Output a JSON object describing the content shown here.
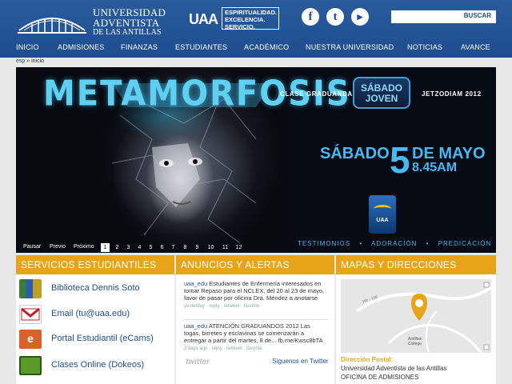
{
  "header": {
    "logo": {
      "line1": "UNIVERSIDAD",
      "line2": "ADVENTISTA",
      "line3": "DE LAS ANTILLAS"
    },
    "mark": "UAA",
    "slogan": [
      "ESPIRITUALIDAD.",
      "EXCELENCIA.",
      "SERVICIO."
    ],
    "social": [
      {
        "name": "facebook-icon",
        "glyph": "f"
      },
      {
        "name": "twitter-icon",
        "glyph": "t"
      },
      {
        "name": "youtube-icon",
        "glyph": "▶"
      }
    ],
    "search": {
      "placeholder": "",
      "button": "BUSCAR"
    }
  },
  "nav": [
    "INICIO",
    "ADMISIONES",
    "FINANZAS",
    "ESTUDIANTES",
    "ACADÉMICO",
    "NUESTRA UNIVERSIDAD",
    "NOTICIAS",
    "AVANCE"
  ],
  "breadcrumb": {
    "home": "esp",
    "sep": " » ",
    "current": "inicio"
  },
  "banner": {
    "title": "METAMORFOSIS",
    "clase": "CLASE GRADUANDA",
    "jetzo": "JETZODIAM 2012",
    "badge_line1": "SÁBADO",
    "badge_line2": "JOVEN",
    "date_day": "SÁBADO",
    "date_num": "5",
    "date_month": "DE MAYO",
    "date_time": "8.45AM",
    "badge_text": "UAA",
    "links": [
      "TESTIMONIOS",
      "•",
      "ADORACIÓN",
      "•",
      "PREDICACIÓN"
    ],
    "controls": {
      "pause": "Pausar",
      "prev": "Previo",
      "next": "Próximo"
    },
    "pages": [
      "1",
      "2",
      "3",
      "4",
      "5",
      "6",
      "7",
      "8",
      "9",
      "10",
      "11",
      "12"
    ],
    "active_page": "1"
  },
  "columns": {
    "servicios": {
      "title": "SERVICIOS ESTUDIANTILES",
      "items": [
        {
          "label": "Biblioteca Dennis Soto",
          "icon": "library-icon",
          "color": "#3a7a3a"
        },
        {
          "label": "Email (tu@uaa.edu)",
          "icon": "email-icon",
          "color": "#c02020"
        },
        {
          "label": "Portal Estudiantil (eCams)",
          "icon": "ecams-icon",
          "color": "#2a7fd0"
        },
        {
          "label": "Clases Online (Dokeos)",
          "icon": "dokeos-icon",
          "color": "#5a9a2a"
        }
      ]
    },
    "anuncios": {
      "title": "ANUNCIOS Y ALERTAS",
      "tweets": [
        {
          "user": "uaa_edu",
          "text": " Estudiantes de Enfermería interesados en tomar Repaso para el NCLEX, del 20 al 23 de mayo, favor de pasar por oficina Dra. Méndez a anotarse",
          "meta": "yesterday · reply · retweet · favorite"
        },
        {
          "user": "uaa_edu",
          "text": " ATENCIÓN GRADUANDOS 2012 Las togas, birretes y esclavinas se comenzarán a entregar a partir del martes, 8 de... fb.me/Kwsc8bTA",
          "meta": "3 days ago · reply · retweet · favorite"
        }
      ],
      "twitter_logo": "twitter",
      "follow": "Síguenos en Twitter"
    },
    "mapas": {
      "title": "MAPAS Y DIRECCIONES",
      "map_road": "PR - 106",
      "map_place": "Antillian College",
      "dir_label": "Dirección Postal:",
      "dir_lines": [
        "Universidad Adventista de las Antillas",
        "OFICINA DE ADMISIONES"
      ]
    }
  }
}
